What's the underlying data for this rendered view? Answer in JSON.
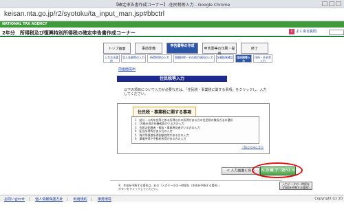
{
  "window": {
    "title": "【確定申告書作成コーナー】-住民税等入力 - Google Chrome"
  },
  "browser": {
    "url": "keisan.nta.go.jp/r2/syotoku/ta_input_man.jsp#bbctrl"
  },
  "agency": {
    "logo": "NATIONAL TAX AGENCY"
  },
  "header": {
    "title": "2年分　所得税及び復興特別所得税の確定申告書作成コーナー",
    "help_label": "よくある質問"
  },
  "steps": [
    {
      "label": "トップ画面"
    },
    {
      "label": "事前準備"
    },
    {
      "label": "申告書等の作成"
    },
    {
      "label": "申告書等の印刷・提出"
    },
    {
      "label": "終了"
    }
  ],
  "substeps": [
    {
      "label": "入力方法選択"
    },
    {
      "label": "収入金額等の入力"
    },
    {
      "label": "所得控除の入力"
    },
    {
      "label": "税額控除・その他の項目の入力"
    },
    {
      "label": "計算結果確認"
    },
    {
      "label": "住民税等入力"
    },
    {
      "label": "住所・氏名等入力"
    }
  ],
  "main": {
    "back_link": "前画面提出",
    "section_title": "住民税等入力",
    "instruction": "以下の項目について入力が必要な方は、「住民税・事業税に関する事項」をクリックし、入力してください。",
    "panel_title": "住民税・事業税に関する事項",
    "list_items": [
      "1　給与・公的年金等に係る所得以外の所得がある方の住民税の徴収方法の選択",
      "2　16歳未満の扶養親族がいる方の入力",
      "3　別居の配偶者・親族・事業専従者がいる方の入力",
      "4　配当所得等がある方の入力",
      "5　株式等譲渡所得割額控除がある方の入力",
      "6　事業所得や不動産所得がある方の入力"
    ],
    "panel_link": "一括じくはこちら",
    "back_button": "< 入力画面に戻る",
    "next_button": "入 力 終 了（次へ）>",
    "note": "※　作成を中断する場合は、右の「入力データの一時保存（作成を中断する場合）」ボタンをクリックしてください。",
    "save_button": "入力データの一時保存（作成を中断する場合）"
  },
  "footer": {
    "links": [
      "お問い合わせ",
      "個人情報保護方針",
      "利用規約",
      "推奨環境"
    ],
    "copyright": "Copyright (c) 20"
  }
}
